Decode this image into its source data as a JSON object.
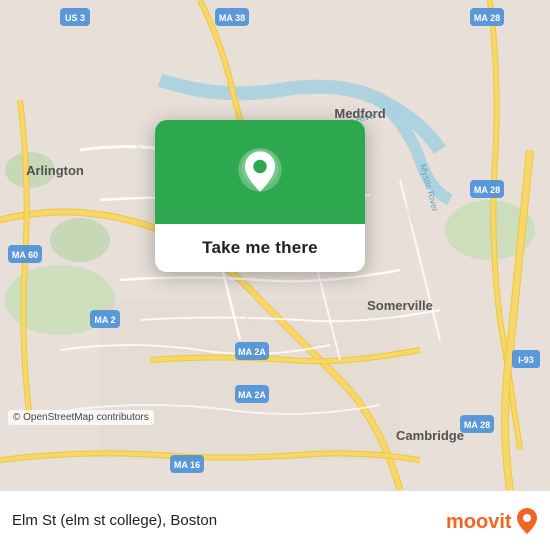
{
  "map": {
    "credit": "© OpenStreetMap contributors",
    "center_lat": 42.405,
    "center_lon": -71.12
  },
  "popup": {
    "button_label": "Take me there"
  },
  "bottom_bar": {
    "location_text": "Elm St (elm st college), Boston",
    "logo_alt": "moovit"
  },
  "icons": {
    "location_pin": "location-pin-icon",
    "moovit_logo": "moovit-logo-icon"
  },
  "colors": {
    "green": "#2ea84f",
    "road_yellow": "#f5d76e",
    "road_white": "#ffffff",
    "water": "#b5d9e8",
    "park": "#c8e6c9",
    "building": "#ddd5c8"
  }
}
